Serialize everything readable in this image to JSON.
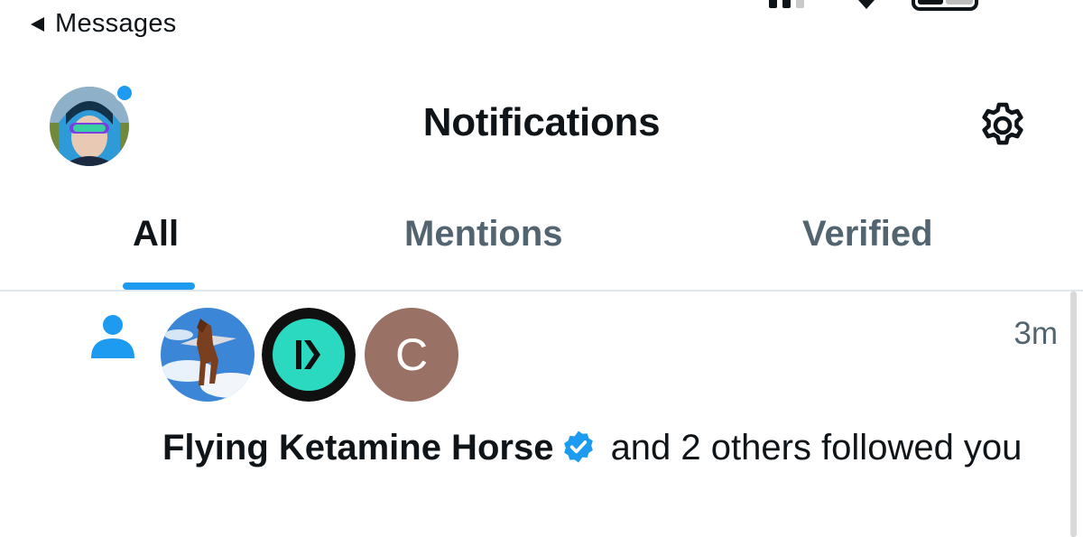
{
  "status_bar": {
    "back_label": "Messages"
  },
  "header": {
    "title": "Notifications"
  },
  "tabs": [
    {
      "label": "All",
      "active": true
    },
    {
      "label": "Mentions",
      "active": false
    },
    {
      "label": "Verified",
      "active": false
    }
  ],
  "notifications": [
    {
      "type_icon": "person-icon",
      "avatars": [
        {
          "name": "Flying Ketamine Horse",
          "kind": "photo"
        },
        {
          "name": "K logo",
          "kind": "logo",
          "letter": "K"
        },
        {
          "name": "C",
          "kind": "initial",
          "letter": "C",
          "color": "#9a7265"
        }
      ],
      "time": "3m",
      "actor": "Flying Ketamine Horse",
      "verified": true,
      "action": "and 2 others followed you"
    }
  ],
  "colors": {
    "accent": "#1d9bf0",
    "text": "#0f1419",
    "muted": "#536471",
    "divider": "#e1e6ea"
  }
}
